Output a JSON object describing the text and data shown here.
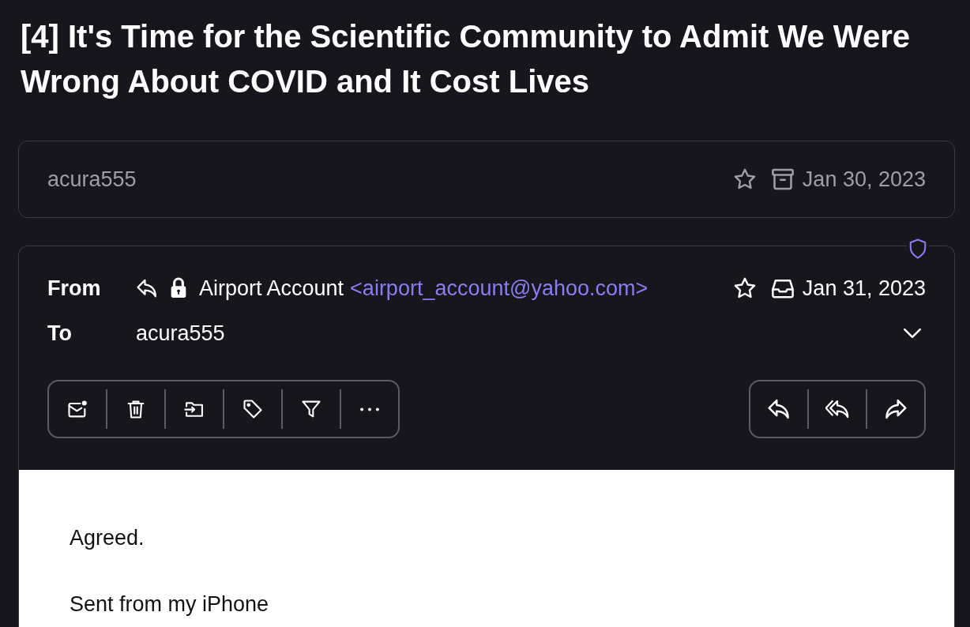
{
  "title": "[4] It's Time for the Scientific Community to Admit We Were Wrong About COVID and It Cost Lives",
  "messages": [
    {
      "expanded": false,
      "sender": "acura555",
      "starred": false,
      "date": "Jan 30, 2023"
    },
    {
      "expanded": true,
      "from_label": "From",
      "sender": "Airport Account",
      "email": "<airport_account@yahoo.com>",
      "starred": false,
      "date": "Jan 31, 2023",
      "to_label": "To",
      "recipient": "acura555",
      "body": [
        "Agreed.",
        "Sent from my iPhone"
      ]
    }
  ]
}
